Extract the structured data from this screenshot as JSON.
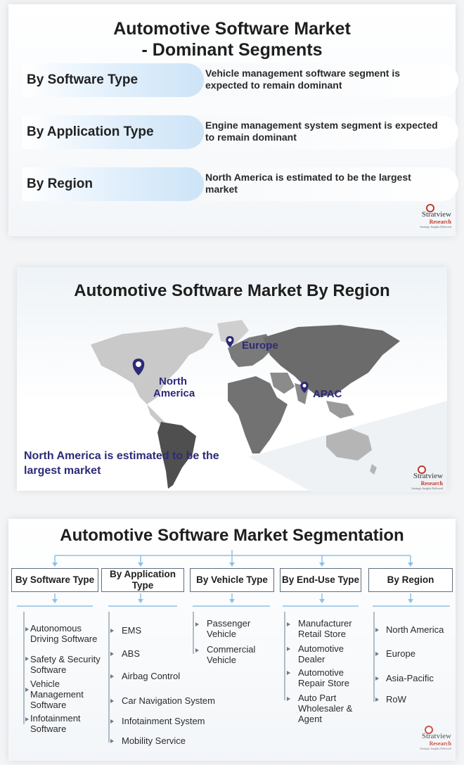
{
  "panel1": {
    "title_line1": "Automotive Software Market",
    "title_line2": "- Dominant Segments",
    "rows": [
      {
        "label": "By Software Type",
        "desc": "Vehicle management software segment is expected to remain dominant"
      },
      {
        "label": "By Application Type",
        "desc": "Engine management system segment is expected to remain dominant"
      },
      {
        "label": "By Region",
        "desc": "North America is estimated to be the largest market"
      }
    ]
  },
  "panel2": {
    "title": "Automotive Software Market By Region",
    "regions": {
      "europe": "Europe",
      "north_america_1": "North",
      "north_america_2": "America",
      "apac": "APAC"
    },
    "note_line1": "North America is estimated to be the",
    "note_line2": "largest market"
  },
  "panel3": {
    "title": "Automotive Software Market Segmentation",
    "categories": [
      {
        "label": "By Software Type",
        "items": [
          "Autonomous Driving Software",
          "Safety & Security Software",
          "Vehicle Management Software",
          "Infotainment Software"
        ]
      },
      {
        "label": "By Application Type",
        "items": [
          "EMS",
          "ABS",
          "Airbag Control",
          "Car Navigation System",
          "Infotainment System",
          "Mobility Service"
        ]
      },
      {
        "label": "By Vehicle Type",
        "items": [
          "Passenger Vehicle",
          "Commercial Vehicle"
        ]
      },
      {
        "label": "By End-Use Type",
        "items": [
          "Manufacturer Retail Store",
          "Automotive Dealer",
          "Automotive Repair Store",
          "Auto Part Wholesaler & Agent"
        ]
      },
      {
        "label": "By Region",
        "items": [
          "North America",
          "Europe",
          "Asia-Pacific",
          "RoW"
        ]
      }
    ]
  },
  "logo": {
    "line1": "Stratview",
    "line2": "Research",
    "line3": "Strategic Insights Delivered"
  },
  "colors": {
    "accent": "#2d2a78",
    "pill": "#d6e9f8",
    "map_dark": "#6e6e6e",
    "map_light": "#c8c8c8"
  },
  "icons": [
    "map-pin-icon",
    "tree-arrow-icon",
    "bullet-triangle-icon"
  ]
}
